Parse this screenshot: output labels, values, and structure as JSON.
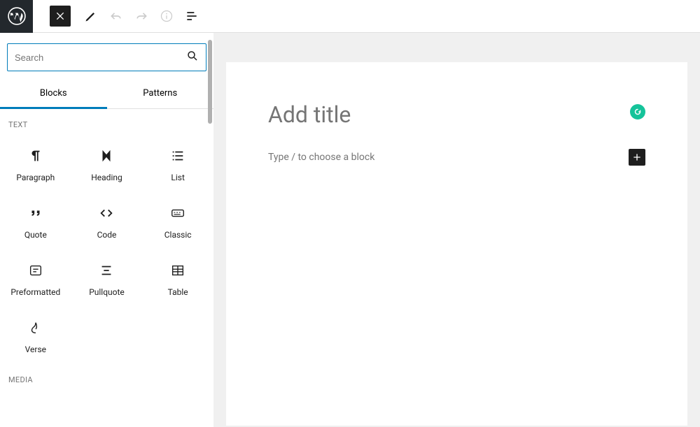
{
  "search": {
    "placeholder": "Search"
  },
  "tabs": {
    "blocks": "Blocks",
    "patterns": "Patterns"
  },
  "sections": {
    "text": "TEXT",
    "media": "MEDIA"
  },
  "blocks": {
    "paragraph": "Paragraph",
    "heading": "Heading",
    "list": "List",
    "quote": "Quote",
    "code": "Code",
    "classic": "Classic",
    "preformatted": "Preformatted",
    "pullquote": "Pullquote",
    "table": "Table",
    "verse": "Verse"
  },
  "editor": {
    "title_placeholder": "Add title",
    "block_hint": "Type / to choose a block"
  }
}
